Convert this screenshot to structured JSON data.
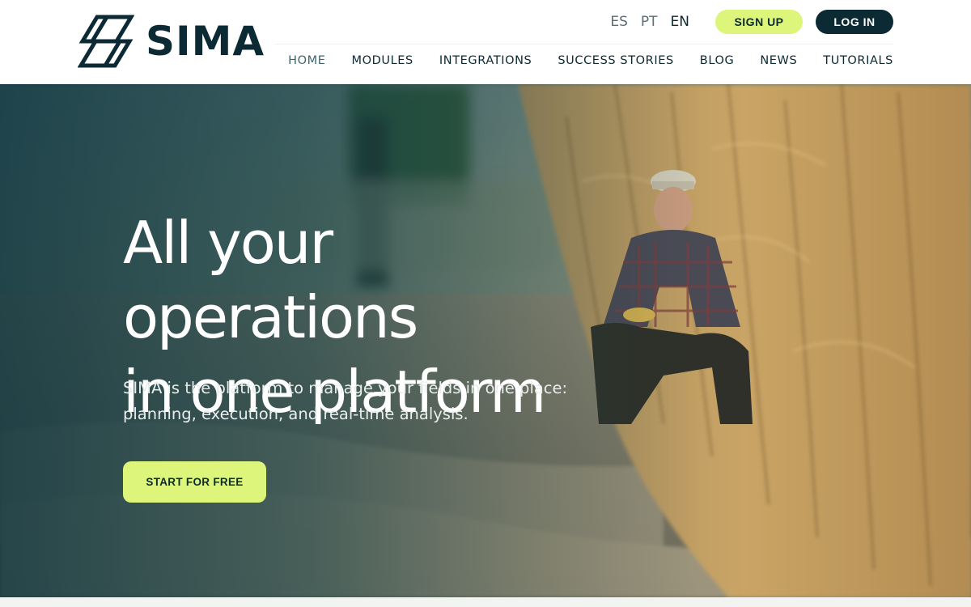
{
  "brand": {
    "name": "SIMA",
    "logo_icon": "sima-logo-mark-icon"
  },
  "languages": [
    {
      "code": "ES",
      "active": false
    },
    {
      "code": "PT",
      "active": false
    },
    {
      "code": "EN",
      "active": true
    }
  ],
  "actions": {
    "signup_label": "SIGN UP",
    "login_label": "LOG IN"
  },
  "nav": {
    "items": [
      {
        "label": "HOME",
        "active": true
      },
      {
        "label": "MODULES",
        "active": false
      },
      {
        "label": "INTEGRATIONS",
        "active": false
      },
      {
        "label": "SUCCESS STORIES",
        "active": false
      },
      {
        "label": "BLOG",
        "active": false
      },
      {
        "label": "NEWS",
        "active": false
      },
      {
        "label": "TUTORIALS",
        "active": false
      }
    ]
  },
  "hero": {
    "title_line1": "All your operations",
    "title_line2": "in one platform",
    "subtitle_line1": "SIMA is the platform to manage your fields in one place:",
    "subtitle_line2": "planning, execution, and real-time analysis.",
    "cta_label": "START FOR FREE",
    "background_image": "farmer-in-corn-field-photo"
  },
  "colors": {
    "brand_dark": "#0b2a33",
    "accent_lime": "#dcf57a",
    "header_bg": "#ffffff",
    "hero_overlay": "#0c343e"
  }
}
